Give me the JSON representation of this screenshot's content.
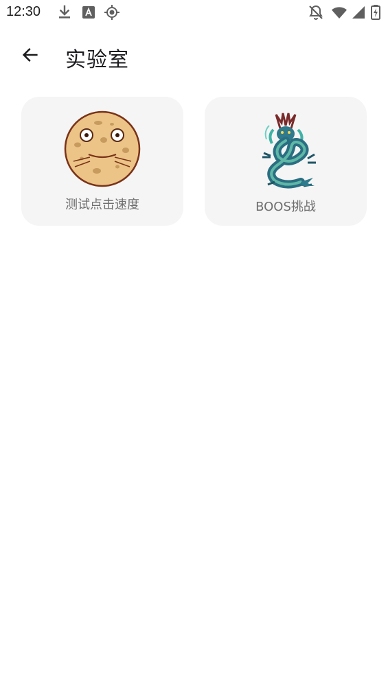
{
  "status_bar": {
    "time": "12:30",
    "icons": [
      "download-icon",
      "text-a-icon",
      "location-target-icon",
      "notifications-off-icon",
      "wifi-icon",
      "signal-icon",
      "battery-charging-icon"
    ]
  },
  "app_bar": {
    "back_icon": "arrow-left-icon",
    "title": "实验室"
  },
  "cards": [
    {
      "label": "测试点击速度",
      "image": "cookie-face-image"
    },
    {
      "label": "BOOS挑战",
      "image": "dragon-image"
    }
  ],
  "colors": {
    "background": "#ffffff",
    "card_background": "#f5f5f5",
    "label_text": "#6e6e6e",
    "title_text": "#1c1b1f"
  }
}
